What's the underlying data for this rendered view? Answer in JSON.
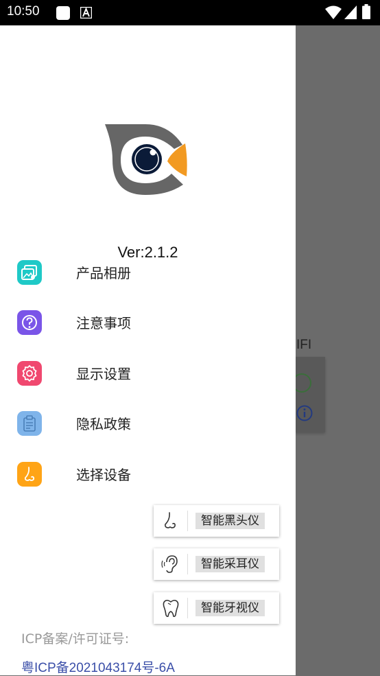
{
  "status_bar": {
    "time": "10:50",
    "icons": [
      "app-square-icon",
      "a-badge-icon",
      "wifi-icon",
      "signal-icon",
      "battery-icon"
    ]
  },
  "background": {
    "partial_text": "IFI"
  },
  "drawer": {
    "version": "Ver:2.1.2",
    "menu": [
      {
        "label": "产品相册",
        "icon": "album-icon",
        "color": "#1fc9c7"
      },
      {
        "label": "注意事项",
        "icon": "help-icon",
        "color": "#7a55e8"
      },
      {
        "label": "显示设置",
        "icon": "gear-icon",
        "color": "#f0486f"
      },
      {
        "label": "隐私政策",
        "icon": "clipboard-icon",
        "color": "#7fb4ea"
      },
      {
        "label": "选择设备",
        "icon": "nose-icon",
        "color": "#ffa416"
      }
    ],
    "devices": [
      {
        "label": "智能黑头仪",
        "icon": "nose-icon"
      },
      {
        "label": "智能采耳仪",
        "icon": "ear-icon"
      },
      {
        "label": "智能牙视仪",
        "icon": "tooth-icon"
      }
    ],
    "icp_label": "ICP备案/许可证号:",
    "icp_number": "粤ICP备2021043174号-6A"
  }
}
